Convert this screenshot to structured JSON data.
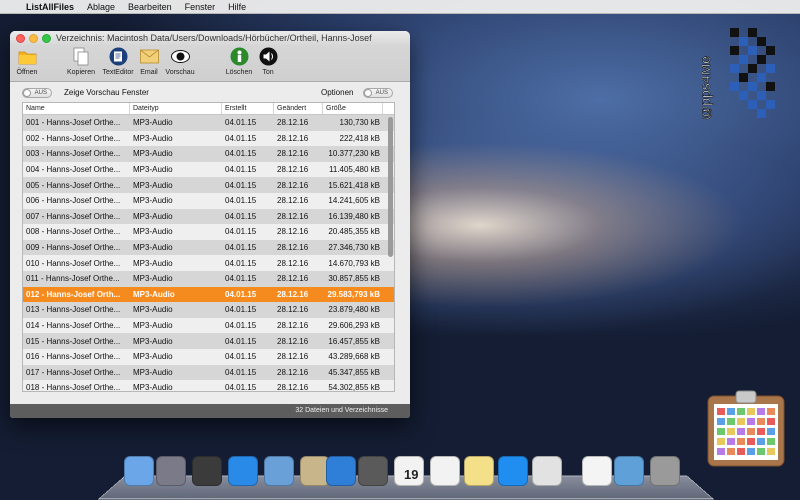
{
  "menubar": {
    "app_name": "ListAllFiles",
    "items": [
      "Ablage",
      "Bearbeiten",
      "Fenster",
      "Hilfe"
    ]
  },
  "window": {
    "title": "Verzeichnis: Macintosh Data/Users/Downloads/Hörbücher/Ortheil, Hanns-Josef",
    "toolbar": {
      "open": "Öffnen",
      "copy": "Kopieren",
      "texteditor": "TextEditor",
      "email": "Email",
      "preview": "Vorschau",
      "delete": "Löschen",
      "sound": "Ton"
    },
    "options_row": {
      "preview_toggle": "AUS",
      "preview_label": "Zeige Vorschau Fenster",
      "options_label": "Optionen",
      "options_toggle": "AUS"
    },
    "table": {
      "headers": [
        "Name",
        "Dateityp",
        "Erstellt",
        "Geändert",
        "Größe"
      ],
      "rows": [
        [
          "001 - Hanns-Josef Orthe...",
          "MP3-Audio",
          "04.01.15",
          "28.12.16",
          "130,730 kB"
        ],
        [
          "002 - Hanns-Josef Orthe...",
          "MP3-Audio",
          "04.01.15",
          "28.12.16",
          "222,418 kB"
        ],
        [
          "003 - Hanns-Josef Orthe...",
          "MP3-Audio",
          "04.01.15",
          "28.12.16",
          "10.377,230 kB"
        ],
        [
          "004 - Hanns-Josef Orthe...",
          "MP3-Audio",
          "04.01.15",
          "28.12.16",
          "11.405,480 kB"
        ],
        [
          "005 - Hanns-Josef Orthe...",
          "MP3-Audio",
          "04.01.15",
          "28.12.16",
          "15.621,418 kB"
        ],
        [
          "006 - Hanns-Josef Orthe...",
          "MP3-Audio",
          "04.01.15",
          "28.12.16",
          "14.241,605 kB"
        ],
        [
          "007 - Hanns-Josef Orthe...",
          "MP3-Audio",
          "04.01.15",
          "28.12.16",
          "16.139,480 kB"
        ],
        [
          "008 - Hanns-Josef Orthe...",
          "MP3-Audio",
          "04.01.15",
          "28.12.16",
          "20.485,355 kB"
        ],
        [
          "009 - Hanns-Josef Orthe...",
          "MP3-Audio",
          "04.01.15",
          "28.12.16",
          "27.346,730 kB"
        ],
        [
          "010 - Hanns-Josef Orthe...",
          "MP3-Audio",
          "04.01.15",
          "28.12.16",
          "14.670,793 kB"
        ],
        [
          "011 - Hanns-Josef Orthe...",
          "MP3-Audio",
          "04.01.15",
          "28.12.16",
          "30.857,855 kB"
        ],
        [
          "012 - Hanns-Josef Orth...",
          "MP3-Audio",
          "04.01.15",
          "28.12.16",
          "29.583,793 kB"
        ],
        [
          "013 - Hanns-Josef Orthe...",
          "MP3-Audio",
          "04.01.15",
          "28.12.16",
          "23.879,480 kB"
        ],
        [
          "014 - Hanns-Josef Orthe...",
          "MP3-Audio",
          "04.01.15",
          "28.12.16",
          "29.606,293 kB"
        ],
        [
          "015 - Hanns-Josef Orthe...",
          "MP3-Audio",
          "04.01.15",
          "28.12.16",
          "16.457,855 kB"
        ],
        [
          "016 - Hanns-Josef Orthe...",
          "MP3-Audio",
          "04.01.15",
          "28.12.16",
          "43.289,668 kB"
        ],
        [
          "017 - Hanns-Josef Orthe...",
          "MP3-Audio",
          "04.01.15",
          "28.12.16",
          "45.347,855 kB"
        ],
        [
          "018 - Hanns-Josef Orthe...",
          "MP3-Audio",
          "04.01.15",
          "28.12.16",
          "54.302,855 kB"
        ]
      ],
      "selected_row": 11
    },
    "status": "32 Dateien und Verzeichnisse"
  },
  "logo": {
    "text": "@pps4Me"
  },
  "dock": {
    "icons": [
      "finder-icon",
      "launchpad-icon",
      "photo-booth-icon",
      "app-store-icon",
      "mail-icon",
      "preview-icon",
      "safari-icon",
      "facetime-icon",
      "contacts-icon",
      "calendar-icon",
      "reminders-icon",
      "notes-icon",
      "itunes-icon",
      "listallfiles-icon",
      "document-icon",
      "downloads-folder-icon",
      "trash-icon"
    ],
    "calendar_day": "19"
  },
  "colors": {
    "selection": "#f58b1e",
    "statusbar": "#5d5d5d"
  }
}
